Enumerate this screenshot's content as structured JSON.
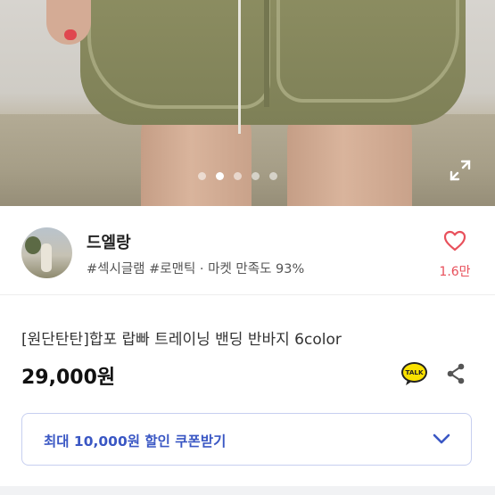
{
  "carousel": {
    "total_slides": 5,
    "active_slide": 2
  },
  "seller": {
    "name": "드엘랑",
    "tags": "#섹시글램 #로맨틱 · 마켓 만족도 93%",
    "likes": "1.6만"
  },
  "product": {
    "title": "[원단탄탄]합포 랍빠 트레이닝 밴딩 반바지 6color",
    "price": "29,000원"
  },
  "coupon": {
    "label": "최대 10,000원 할인 쿠폰받기"
  },
  "icons": {
    "like": "heart-icon",
    "talk": "kakaotalk-icon",
    "share": "share-icon",
    "expand": "expand-icon",
    "chevron": "chevron-down-icon"
  },
  "colors": {
    "like_red": "#e8505b",
    "coupon_blue": "#3a57c4",
    "talk_yellow": "#fae100"
  }
}
